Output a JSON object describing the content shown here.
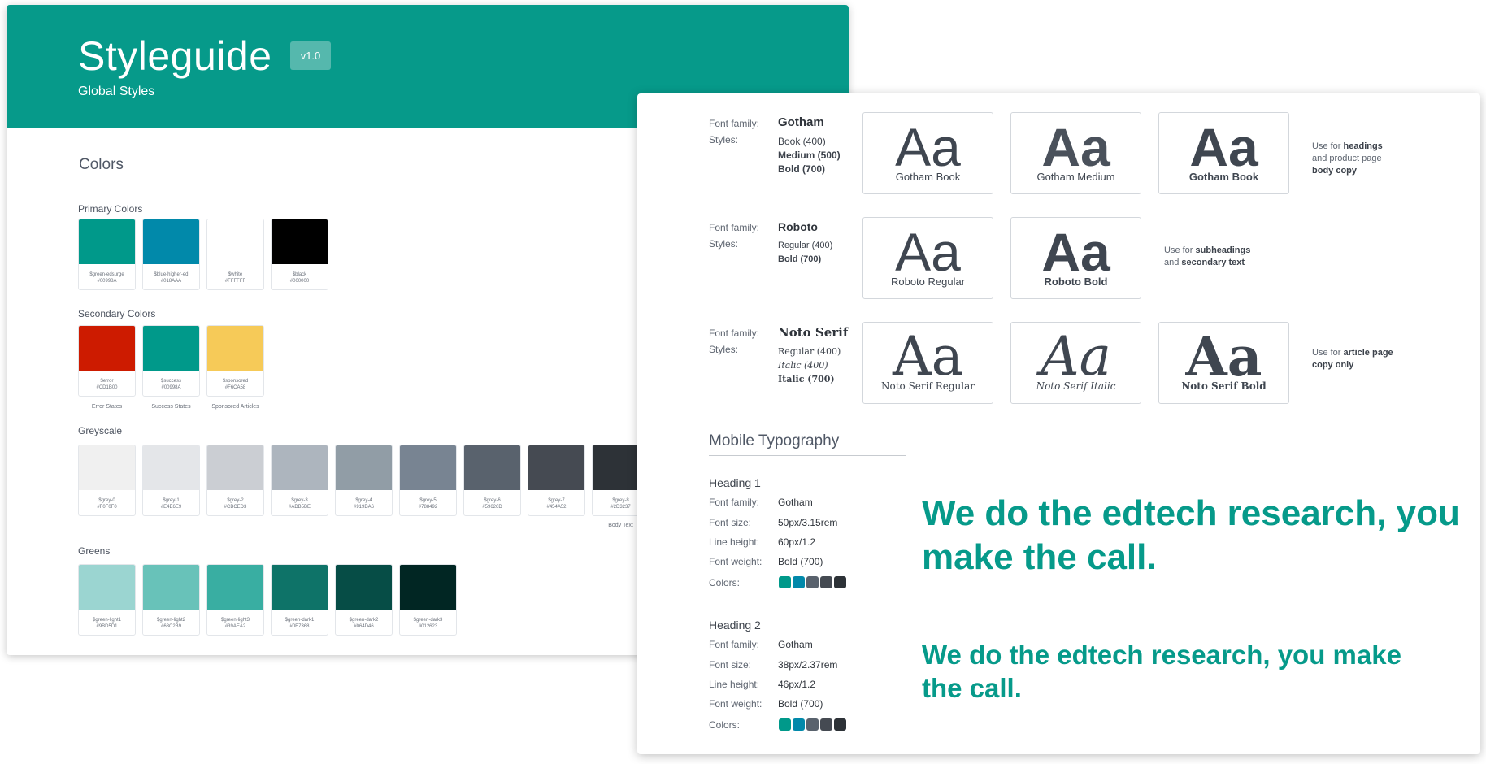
{
  "back": {
    "title": "Styleguide",
    "version": "v1.0",
    "subtitle": "Global Styles",
    "colors_heading": "Colors",
    "primary": {
      "label": "Primary Colors",
      "swatches": [
        {
          "name": "$green-edsurge",
          "hex": "#00998A",
          "color": "#00998a"
        },
        {
          "name": "$blue-higher-ed",
          "hex": "#018AAA",
          "color": "#0189aa"
        },
        {
          "name": "$white",
          "hex": "#FFFFFF",
          "color": "#ffffff"
        },
        {
          "name": "$black",
          "hex": "#000000",
          "color": "#000000"
        }
      ]
    },
    "secondary": {
      "label": "Secondary Colors",
      "swatches": [
        {
          "name": "$error",
          "hex": "#CD1B00",
          "color": "#cd1b00",
          "note": "Error States"
        },
        {
          "name": "$success",
          "hex": "#00998A",
          "color": "#00998a",
          "note": "Success States"
        },
        {
          "name": "$sponsored",
          "hex": "#F6CA58",
          "color": "#f6ca58",
          "note": "Sponsored Articles"
        }
      ]
    },
    "greyscale": {
      "label": "Greyscale",
      "swatches": [
        {
          "name": "$grey-0",
          "hex": "#F0F0F0",
          "color": "#f0f0f0"
        },
        {
          "name": "$grey-1",
          "hex": "#E4E6E9",
          "color": "#e4e6e9"
        },
        {
          "name": "$grey-2",
          "hex": "#CBCED3",
          "color": "#cbced3"
        },
        {
          "name": "$grey-3",
          "hex": "#ADB5BE",
          "color": "#adb5be"
        },
        {
          "name": "$grey-4",
          "hex": "#919DA6",
          "color": "#919da6"
        },
        {
          "name": "$grey-5",
          "hex": "#788492",
          "color": "#788492"
        },
        {
          "name": "$grey-6",
          "hex": "#59626D",
          "color": "#59626d"
        },
        {
          "name": "$grey-7",
          "hex": "#454A52",
          "color": "#454a52"
        },
        {
          "name": "$grey-8",
          "hex": "#2D3237",
          "color": "#2d3237",
          "note": "Body Text"
        }
      ]
    },
    "greens": {
      "label": "Greens",
      "swatches": [
        {
          "name": "$green-light1",
          "hex": "#9BD5D1",
          "color": "#9bd5d1"
        },
        {
          "name": "$green-light2",
          "hex": "#68C2B9",
          "color": "#68c2b9"
        },
        {
          "name": "$green-light3",
          "hex": "#39AEA2",
          "color": "#39aea2"
        },
        {
          "name": "$green-dark1",
          "hex": "#0E7368",
          "color": "#0e7368"
        },
        {
          "name": "$green-dark2",
          "hex": "#064D46",
          "color": "#064d46"
        },
        {
          "name": "$green-dark3",
          "hex": "#012623",
          "color": "#012623"
        }
      ]
    }
  },
  "front": {
    "families": [
      {
        "family_label": "Font family:",
        "styles_label": "Styles:",
        "name": "Gotham",
        "styles": [
          "Book (400)",
          "Medium (500)",
          "Bold (700)"
        ],
        "specimens": [
          {
            "glyph": "Aa",
            "label": "Gotham Book"
          },
          {
            "glyph": "Aa",
            "label": "Gotham Medium"
          },
          {
            "glyph": "Aa",
            "label": "Gotham Book"
          }
        ],
        "use": {
          "prefix": "Use for ",
          "b1": "headings",
          "mid": "and product page",
          "b2": "body copy"
        }
      },
      {
        "family_label": "Font family:",
        "styles_label": "Styles:",
        "name": "Roboto",
        "styles": [
          "Regular (400)",
          "Bold (700)"
        ],
        "specimens": [
          {
            "glyph": "Aa",
            "label": "Roboto Regular"
          },
          {
            "glyph": "Aa",
            "label": "Roboto Bold"
          }
        ],
        "use": {
          "prefix": "Use for ",
          "b1": "subheadings",
          "mid": "and ",
          "b2": "secondary text"
        }
      },
      {
        "family_label": "Font family:",
        "styles_label": "Styles:",
        "name": "Noto Serif",
        "styles": [
          "Regular (400)",
          "Italic (400)",
          "Italic (700)"
        ],
        "specimens": [
          {
            "glyph": "Aa",
            "label": "Noto Serif Regular"
          },
          {
            "glyph": "Aa",
            "label": "Noto Serif Italic"
          },
          {
            "glyph": "Aa",
            "label": "Noto Serif Bold"
          }
        ],
        "use": {
          "prefix": "Use for ",
          "b1": "article page",
          "b2": "copy only"
        }
      }
    ],
    "mobile_title": "Mobile Typography",
    "headings": [
      {
        "title": "Heading 1",
        "rows": [
          {
            "key": "Font family:",
            "val": "Gotham"
          },
          {
            "key": "Font size:",
            "val": "50px/3.15rem"
          },
          {
            "key": "Line height:",
            "val": "60px/1.2"
          },
          {
            "key": "Font weight:",
            "val": "Bold (700)"
          },
          {
            "key": "Colors:",
            "val": ""
          }
        ],
        "sample": "We do the edtech research, you make the call."
      },
      {
        "title": "Heading 2",
        "rows": [
          {
            "key": "Font family:",
            "val": "Gotham"
          },
          {
            "key": "Font size:",
            "val": "38px/2.37rem"
          },
          {
            "key": "Line height:",
            "val": "46px/1.2"
          },
          {
            "key": "Font weight:",
            "val": "Bold (700)"
          },
          {
            "key": "Colors:",
            "val": ""
          }
        ],
        "sample": "We do the edtech research, you make the call."
      }
    ],
    "dot_colors": [
      "#00998a",
      "#0189aa",
      "#59626d",
      "#454a52",
      "#2d3237"
    ]
  }
}
